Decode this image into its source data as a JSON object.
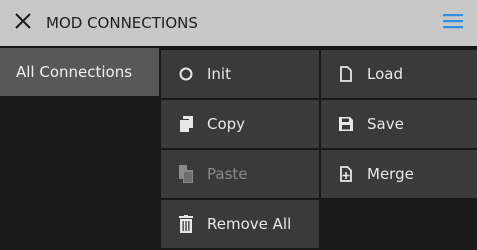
{
  "header": {
    "title": "MOD CONNECTIONS"
  },
  "sidebar": {
    "items": [
      {
        "label": "All Connections"
      }
    ]
  },
  "actions": {
    "init_label": "Init",
    "copy_label": "Copy",
    "paste_label": "Paste",
    "remove_all_label": "Remove All",
    "load_label": "Load",
    "save_label": "Save",
    "merge_label": "Merge"
  },
  "colors": {
    "header_bg": "#c8c8c8",
    "menu_accent": "#2f8fe8",
    "cell_bg": "#3a3a3a",
    "selected_bg": "#585858"
  },
  "icons": {
    "close": "close-icon",
    "menu": "hamburger-menu-icon",
    "init": "circle-icon",
    "copy": "copy-icon",
    "paste": "paste-icon",
    "remove_all": "trash-icon",
    "load": "file-icon",
    "save": "floppy-disk-icon",
    "merge": "file-plus-icon"
  }
}
